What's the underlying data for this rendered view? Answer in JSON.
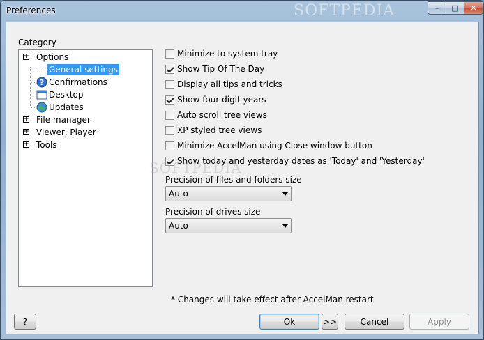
{
  "window": {
    "title": "Preferences",
    "controls": {
      "minimize": "–",
      "maximize": "□",
      "close": "✕"
    }
  },
  "category": {
    "label": "Category",
    "tree": [
      {
        "label": "Options",
        "expander": "+"
      },
      {
        "label": "General settings",
        "selected": true,
        "icon": "none"
      },
      {
        "label": "Confirmations",
        "icon": "help-question-icon"
      },
      {
        "label": "Desktop",
        "icon": "desktop-window-icon"
      },
      {
        "label": "Updates",
        "icon": "globe-update-icon"
      },
      {
        "label": "File manager",
        "expander": "+"
      },
      {
        "label": "Viewer, Player",
        "expander": "+"
      },
      {
        "label": "Tools",
        "expander": "+"
      }
    ]
  },
  "settings": {
    "checkboxes": [
      {
        "label": "Minimize to system tray",
        "checked": false
      },
      {
        "label": "Show Tip Of The Day",
        "checked": true
      },
      {
        "label": "Display all tips and tricks",
        "checked": false
      },
      {
        "label": "Show four digit years",
        "checked": true
      },
      {
        "label": "Auto scroll tree views",
        "checked": false
      },
      {
        "label": "XP styled tree views",
        "checked": false
      },
      {
        "label": "Minimize AccelMan using Close window button",
        "checked": false
      },
      {
        "label": "Show today and yesterday dates as 'Today' and 'Yesterday'",
        "checked": true
      }
    ],
    "files_precision": {
      "label": "Precision of files and folders size",
      "value": "Auto"
    },
    "drives_precision": {
      "label": "Precision of drives size",
      "value": "Auto"
    },
    "note": "* Changes will take effect after AccelMan restart"
  },
  "buttons": {
    "help": "?",
    "ok": "Ok",
    "more": ">>",
    "cancel": "Cancel",
    "apply": "Apply"
  },
  "watermark": {
    "title_bar": "SOFTPEDIA",
    "center": "SOFTPEDIA"
  },
  "colors": {
    "selection": "#3399ff",
    "titlebar": "#a9c3dc"
  }
}
